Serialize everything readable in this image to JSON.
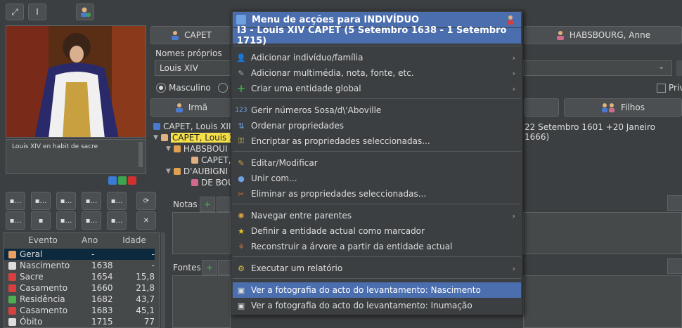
{
  "toolbar": {
    "btn1_glyph": "⤢",
    "btn2_glyph": "I",
    "btn3_glyph": "👤"
  },
  "portrait": {
    "caption": "Louis XIV en habit de sacre"
  },
  "header_buttons": {
    "father": "CAPET",
    "mother": "HABSBOURG, Anne",
    "siblings": "Irmã",
    "children": "Filhos"
  },
  "names": {
    "label": "Nomes próprios",
    "value": "Louis XIV"
  },
  "sex": {
    "male": "Masculino",
    "private": "Priv"
  },
  "tree": {
    "row0": "CAPET, Louis XIII",
    "row1": "CAPET, Louis X",
    "row2": "HABSBOUI",
    "row3": "CAPET,",
    "row4": "D'AUBIGNI",
    "row5": "DE BOU",
    "right_text": "22 Setembro 1601 +20 Janeiro 1666)"
  },
  "sections": {
    "notes": "Notas",
    "sources": "Fontes"
  },
  "events": {
    "headers": [
      "Evento",
      "Ano",
      "Idade"
    ],
    "rows": [
      {
        "name": "Geral",
        "year": "-",
        "age": "-",
        "color": "#e8a060"
      },
      {
        "name": "Nascimento",
        "year": "1638",
        "age": "-",
        "color": "#dddddd"
      },
      {
        "name": "Sacre",
        "year": "1654",
        "age": "15,8",
        "color": "#d84040"
      },
      {
        "name": "Casamento",
        "year": "1660",
        "age": "21,8",
        "color": "#d84040"
      },
      {
        "name": "Residência",
        "year": "1682",
        "age": "43,7",
        "color": "#4caf50"
      },
      {
        "name": "Casamento",
        "year": "1683",
        "age": "45,1",
        "color": "#d84040"
      },
      {
        "name": "Óbito",
        "year": "1715",
        "age": "77",
        "color": "#dddddd"
      }
    ]
  },
  "menu": {
    "title": "Menu de acções para INDIVÍDUO",
    "subtitle": "I3 - Louis XIV CAPET (5 Setembro 1638 - 1 Setembro 1715)",
    "items": [
      "Adicionar indivíduo/família",
      "Adicionar multimédia, nota, fonte, etc.",
      "Criar uma entidade global",
      "Gerir números Sosa/d\\'Aboville",
      "Ordenar propriedades",
      "Encriptar as propriedades seleccionadas...",
      "Editar/Modificar",
      "Unir com...",
      "Eliminar as propriedades seleccionadas...",
      "Navegar entre parentes",
      "Definir a entidade actual como marcador",
      "Reconstruir a árvore a partir da entidade actual",
      "Executar um relatório",
      "Ver a fotografia do acto do levantamento: Nascimento",
      "Ver a fotografia do acto do levantamento: Inumação"
    ]
  }
}
